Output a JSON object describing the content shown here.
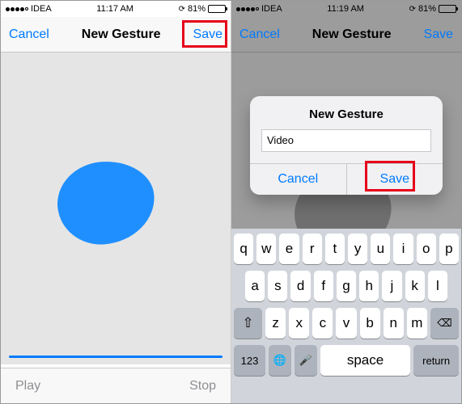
{
  "left": {
    "status": {
      "carrier": "IDEA",
      "time": "11:17 AM",
      "battery": "81%"
    },
    "nav": {
      "cancel": "Cancel",
      "title": "New Gesture",
      "save": "Save"
    },
    "bottom": {
      "play": "Play",
      "stop": "Stop"
    }
  },
  "right": {
    "status": {
      "carrier": "IDEA",
      "time": "11:19 AM",
      "battery": "81%"
    },
    "nav": {
      "cancel": "Cancel",
      "title": "New Gesture",
      "save": "Save"
    },
    "alert": {
      "title": "New Gesture",
      "input_value": "Video",
      "cancel": "Cancel",
      "save": "Save"
    },
    "keyboard": {
      "row1": [
        "q",
        "w",
        "e",
        "r",
        "t",
        "y",
        "u",
        "i",
        "o",
        "p"
      ],
      "row2": [
        "a",
        "s",
        "d",
        "f",
        "g",
        "h",
        "j",
        "k",
        "l"
      ],
      "row3": [
        "z",
        "x",
        "c",
        "v",
        "b",
        "n",
        "m"
      ],
      "shift": "⇧",
      "backspace": "⌫",
      "numkey": "123",
      "globe": "🌐",
      "mic": "🎤",
      "space": "space",
      "return": "return"
    }
  }
}
